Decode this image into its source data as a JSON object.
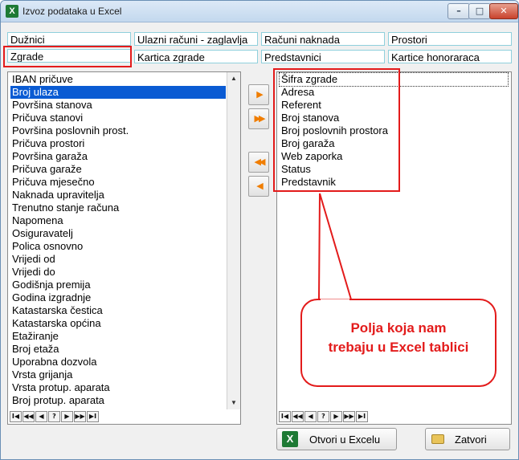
{
  "window": {
    "title": "Izvoz podataka u Excel",
    "app_icon_glyph": "X"
  },
  "tabs_row1": [
    "Dužnici",
    "Ulazni računi - zaglavlja",
    "Računi naknada",
    "Prostori"
  ],
  "tabs_row2": [
    "Zgrade",
    "Kartica zgrade",
    "Predstavnici",
    "Kartice honoraraca"
  ],
  "available_fields": [
    "IBAN pričuve",
    "Broj ulaza",
    "Površina stanova",
    "Pričuva stanovi",
    "Površina poslovnih prost.",
    "Pričuva prostori",
    "Površina garaža",
    "Pričuva garaže",
    "Pričuva mjesečno",
    "Naknada upravitelja",
    "Trenutno stanje računa",
    "Napomena",
    "Osiguravatelj",
    "Polica osnovno",
    "Vrijedi od",
    "Vrijedi do",
    "Godišnja premija",
    "Godina izgradnje",
    "Katastarska čestica",
    "Katastarska općina",
    "Etažiranje",
    "Broj etaža",
    "Uporabna dozvola",
    "Vrsta grijanja",
    "Vrsta protup. aparata",
    "Broj protup. aparata"
  ],
  "selected_index": 1,
  "export_fields": [
    "Šifra zgrade",
    "Adresa",
    "Referent",
    "Broj stanova",
    "Broj poslovnih prostora",
    "Broj garaža",
    "Web zaporka",
    "Status",
    "Predstavnik"
  ],
  "nav_buttons": [
    "I◀",
    "◀◀",
    "◀",
    "?",
    "▶",
    "▶▶",
    "▶I"
  ],
  "callout": {
    "line1": "Polja koja nam",
    "line2": "trebaju u Excel tablici"
  },
  "buttons": {
    "export": "Otvori u Excelu",
    "close": "Zatvori"
  },
  "colors": {
    "highlight": "#e31b1b",
    "selection": "#0a5bd3",
    "arrows": "#f07d00"
  }
}
